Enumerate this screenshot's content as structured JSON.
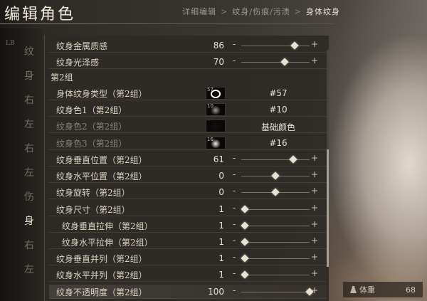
{
  "header": {
    "title": "编辑角色",
    "breadcrumb": [
      "详细编辑",
      "纹身/伤痕/污渍",
      "身体纹身"
    ],
    "breadcrumb_sep": ">"
  },
  "left_strip": [
    "纹",
    "身",
    "右",
    "左",
    "右",
    "左",
    "伤",
    "身",
    "右",
    "左"
  ],
  "left_strip_badge": "LB",
  "rows_top": [
    {
      "label": "纹身金属质感",
      "value": "86",
      "slider": 0.78
    },
    {
      "label": "纹身光泽感",
      "value": "70",
      "slider": 0.64
    }
  ],
  "section": "第2组",
  "rows_type": [
    {
      "label": "身体纹身类型（第2组）",
      "swatch_num": "57",
      "ref": "#57",
      "swatch_color": "#ffffff"
    },
    {
      "label": "纹身色1（第2组）",
      "swatch_num": "10",
      "ref": "#10",
      "swatch_color": "#9a9a9a"
    },
    {
      "label": "纹身色2（第2组）",
      "swatch_num": "",
      "ref": "基础颜色",
      "swatch_color": "#111111",
      "disabled": true
    },
    {
      "label": "纹身色3（第2组）",
      "swatch_num": "16",
      "ref": "#16",
      "swatch_color": "#f2f2f2",
      "disabled": true
    }
  ],
  "rows_bottom": [
    {
      "label": "纹身垂直位置（第2组）",
      "value": "61",
      "slider": 0.76
    },
    {
      "label": "纹身水平位置（第2组）",
      "value": "0",
      "slider": 0.5
    },
    {
      "label": "纹身旋转（第2组）",
      "value": "0",
      "slider": 0.5
    },
    {
      "label": "纹身尺寸（第2组）",
      "value": "1",
      "slider": 0.05
    },
    {
      "label": "纹身垂直拉伸（第2组）",
      "value": "1",
      "slider": 0.05,
      "indent": true
    },
    {
      "label": "纹身水平拉伸（第2组）",
      "value": "1",
      "slider": 0.05,
      "indent": true
    },
    {
      "label": "纹身垂直并列（第2组）",
      "value": "1",
      "slider": 0.05
    },
    {
      "label": "纹身水平并列（第2组）",
      "value": "1",
      "slider": 0.05
    },
    {
      "label": "纹身不透明度（第2组）",
      "value": "100",
      "slider": 1.0,
      "selected": true
    }
  ],
  "slider_minus": "-",
  "slider_plus": "+",
  "weight": {
    "label": "体重",
    "value": "68"
  }
}
